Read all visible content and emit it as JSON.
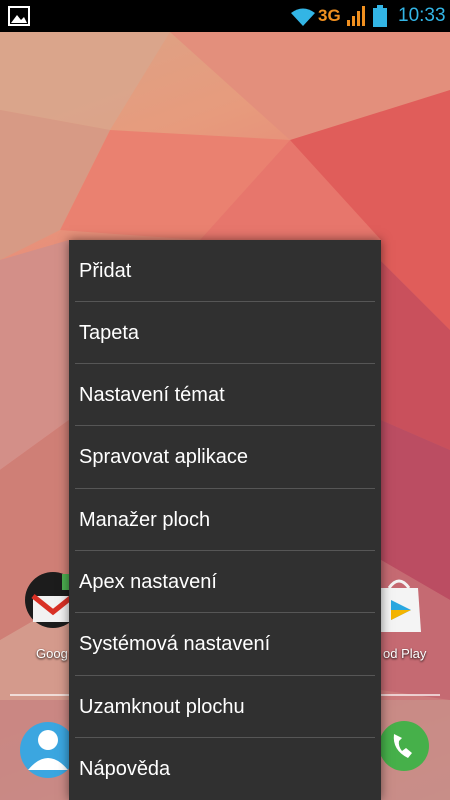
{
  "status_bar": {
    "network_type": "3G",
    "time": "10:33",
    "icons": [
      "gallery-notification-icon",
      "wifi-icon",
      "signal-icon",
      "battery-icon"
    ],
    "colors": {
      "time": "#33b5e5",
      "network": "#f09020",
      "battery": "#33b5e5"
    }
  },
  "home": {
    "gmail_label": "Goog",
    "play_label": "od Play"
  },
  "menu": {
    "items": [
      {
        "label": "Přidat"
      },
      {
        "label": "Tapeta"
      },
      {
        "label": "Nastavení témat"
      },
      {
        "label": "Spravovat aplikace"
      },
      {
        "label": "Manažer ploch"
      },
      {
        "label": "Apex nastavení"
      },
      {
        "label": "Systémová nastavení"
      },
      {
        "label": "Uzamknout plochu"
      },
      {
        "label": "Nápověda"
      }
    ]
  }
}
